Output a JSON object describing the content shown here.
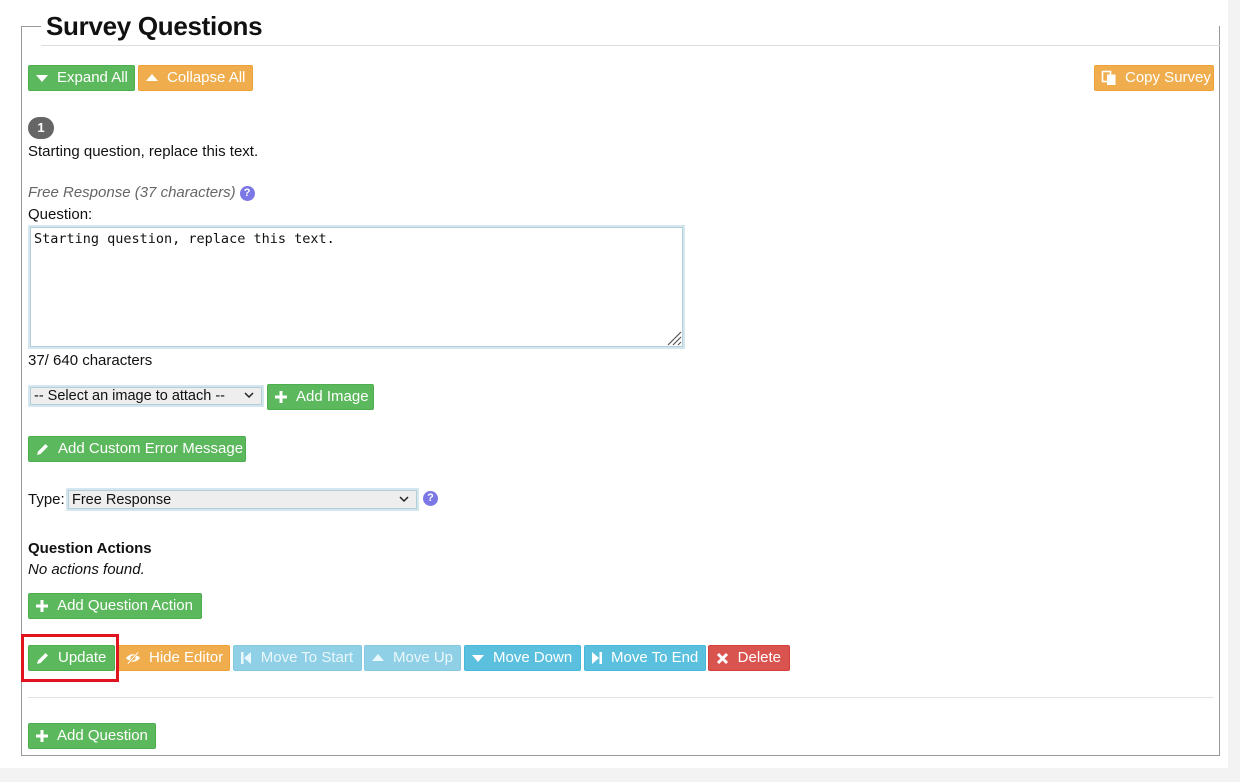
{
  "header": {
    "title": "Survey Questions"
  },
  "toolbar": {
    "expand_all": "Expand All",
    "collapse_all": "Collapse All",
    "copy_survey": "Copy Survey"
  },
  "question": {
    "number": "1",
    "summary_text": "Starting question, replace this text.",
    "type_info": "Free Response (37 characters)",
    "question_label": "Question:",
    "question_value": "Starting question, replace this text.",
    "char_count": "37/ 640 characters",
    "image_select": {
      "selected": "-- Select an image to attach --"
    },
    "add_image": "Add Image",
    "add_custom_error": "Add Custom Error Message",
    "type_label": "Type:",
    "type_select": {
      "selected": "Free Response"
    },
    "actions_heading": "Question Actions",
    "no_actions": "No actions found.",
    "add_question_action": "Add Question Action"
  },
  "editor_buttons": {
    "update": "Update",
    "hide_editor": "Hide Editor",
    "move_to_start": "Move To Start",
    "move_up": "Move Up",
    "move_down": "Move Down",
    "move_to_end": "Move To End",
    "delete": "Delete"
  },
  "footer": {
    "add_question": "Add Question"
  },
  "colors": {
    "green": "#5cb85c",
    "orange": "#f0ad4e",
    "light_blue_disabled": "#8fd0e6",
    "blue": "#5bc0de",
    "red": "#d9534f",
    "help_icon": "#7b78e6",
    "highlight": "#e0141e"
  },
  "icons": {
    "expand_all": "caret-down-icon",
    "collapse_all": "caret-up-icon",
    "copy_survey": "copy-icon",
    "help": "question-circle-icon",
    "add": "plus-icon",
    "edit": "pencil-icon",
    "hide": "eye-slash-icon",
    "move_to_start": "step-backward-icon",
    "move_up": "caret-up-icon",
    "move_down": "caret-down-icon",
    "move_to_end": "step-forward-icon",
    "delete": "times-icon"
  }
}
